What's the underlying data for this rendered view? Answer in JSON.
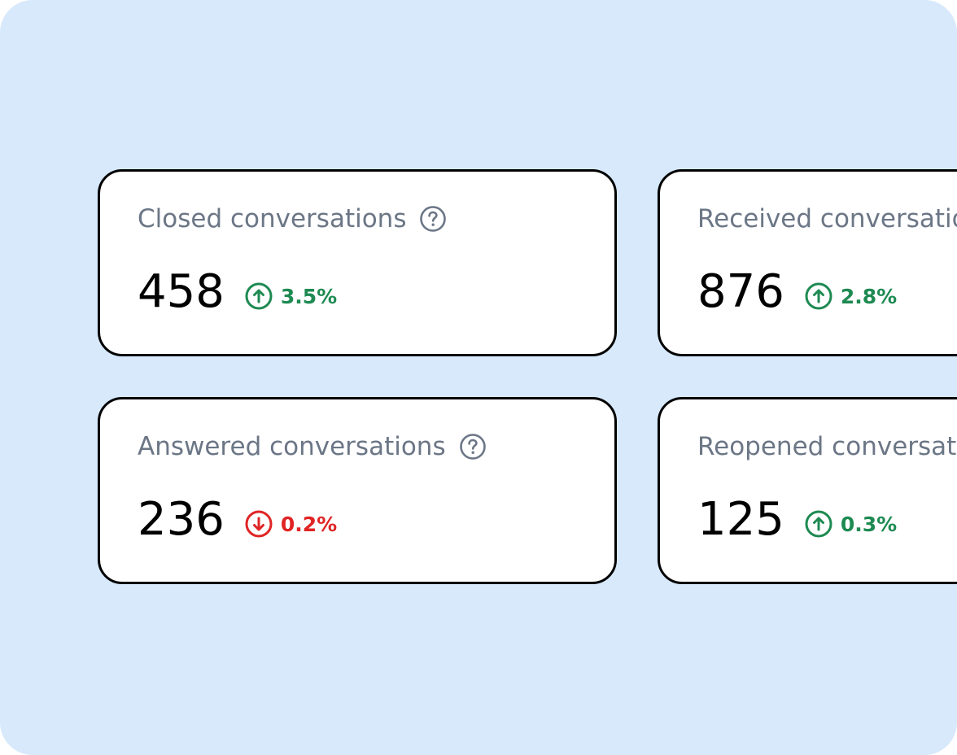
{
  "background_color": "#d7e9fb",
  "colors": {
    "label": "#6b7686",
    "up": "#1e8a52",
    "down": "#e02424"
  },
  "cards": [
    {
      "label": "Closed conversations",
      "value": "458",
      "trend": "3.5%",
      "direction": "up",
      "trend_icon": "arrow-up-circle-icon"
    },
    {
      "label": "Received conversations",
      "value": "876",
      "trend": "2.8%",
      "direction": "up",
      "trend_icon": "arrow-up-circle-icon"
    },
    {
      "label": "Answered conversations",
      "value": "236",
      "trend": "0.2%",
      "direction": "down",
      "trend_icon": "arrow-down-circle-icon"
    },
    {
      "label": "Reopened conversations",
      "value": "125",
      "trend": "0.3%",
      "direction": "up",
      "trend_icon": "arrow-up-circle-icon"
    }
  ]
}
